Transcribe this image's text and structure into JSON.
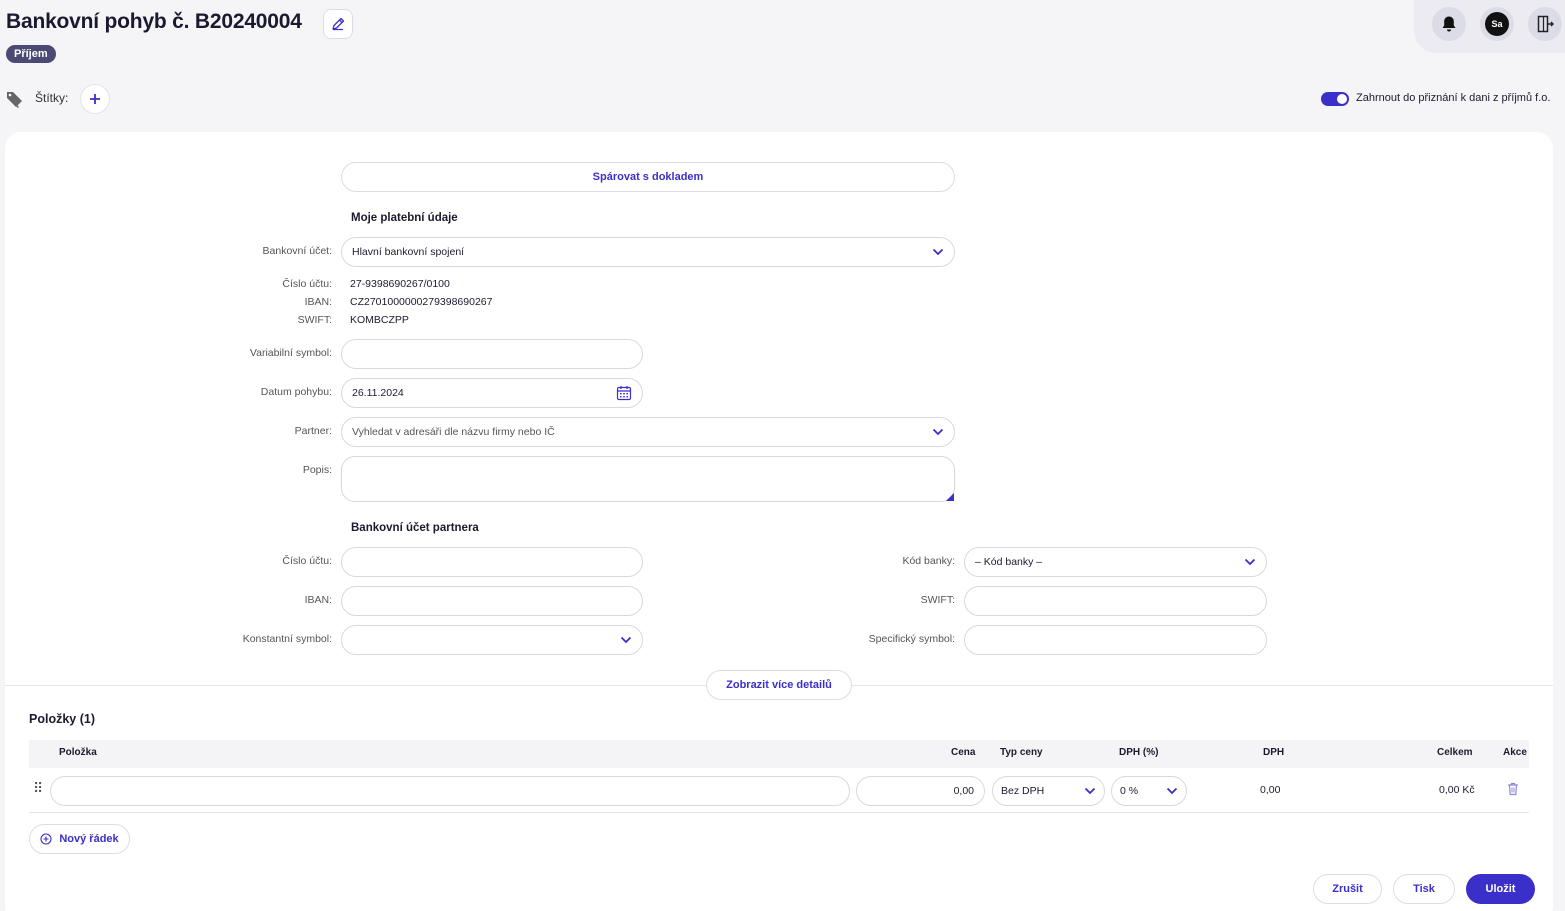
{
  "header": {
    "title": "Bankovní pohyb č. B20240004",
    "type_badge": "Příjem",
    "avatar_initials": "Sa",
    "icons": [
      "edit-icon",
      "bell-icon",
      "logout-icon"
    ]
  },
  "tags": {
    "label": "Štítky:"
  },
  "tax_toggle": {
    "label": "Zahrnout do přiznání k dani z příjmů f.o.",
    "on": true
  },
  "form": {
    "pair_button": "Spárovat s dokladem",
    "my_payment_title": "Moje platební údaje",
    "bank_account": {
      "label": "Bankovní účet:",
      "value": "Hlavní bankovní spojení"
    },
    "account_number": {
      "label": "Číslo účtu:",
      "value": "27-9398690267/0100"
    },
    "iban": {
      "label": "IBAN:",
      "value": "CZ2701000000279398690267"
    },
    "swift": {
      "label": "SWIFT:",
      "value": "KOMBCZPP"
    },
    "variable_symbol": {
      "label": "Variabilní symbol:",
      "value": ""
    },
    "date": {
      "label": "Datum pohybu:",
      "value": "26.11.2024"
    },
    "partner": {
      "label": "Partner:",
      "placeholder": "Vyhledat v adresáři dle názvu firmy nebo IČ"
    },
    "description": {
      "label": "Popis:",
      "value": ""
    },
    "partner_account_title": "Bankovní účet partnera",
    "partner_account_number": {
      "label": "Číslo účtu:",
      "value": ""
    },
    "partner_iban": {
      "label": "IBAN:",
      "value": ""
    },
    "constant_symbol": {
      "label": "Konstantní symbol:",
      "value": ""
    },
    "bank_code": {
      "label": "Kód banky:",
      "value": "– Kód banky –"
    },
    "partner_swift": {
      "label": "SWIFT:",
      "value": ""
    },
    "specific_symbol": {
      "label": "Specifický symbol:",
      "value": ""
    },
    "more_details_button": "Zobrazit více detailů"
  },
  "items": {
    "title": "Položky (1)",
    "columns": {
      "item": "Položka",
      "price": "Cena",
      "price_type": "Typ ceny",
      "vat_rate": "DPH (%)",
      "vat": "DPH",
      "total": "Celkem",
      "actions": "Akce"
    },
    "rows": [
      {
        "item": "",
        "price": "0,00",
        "price_type": "Bez DPH",
        "vat_rate": "0 %",
        "vat": "0,00",
        "total": "0,00 Kč"
      }
    ],
    "new_row_button": "Nový řádek"
  },
  "footer": {
    "cancel": "Zrušit",
    "print": "Tisk",
    "save": "Uložit"
  },
  "colors": {
    "accent": "#3b2fc9",
    "badge": "#4b4a74"
  }
}
